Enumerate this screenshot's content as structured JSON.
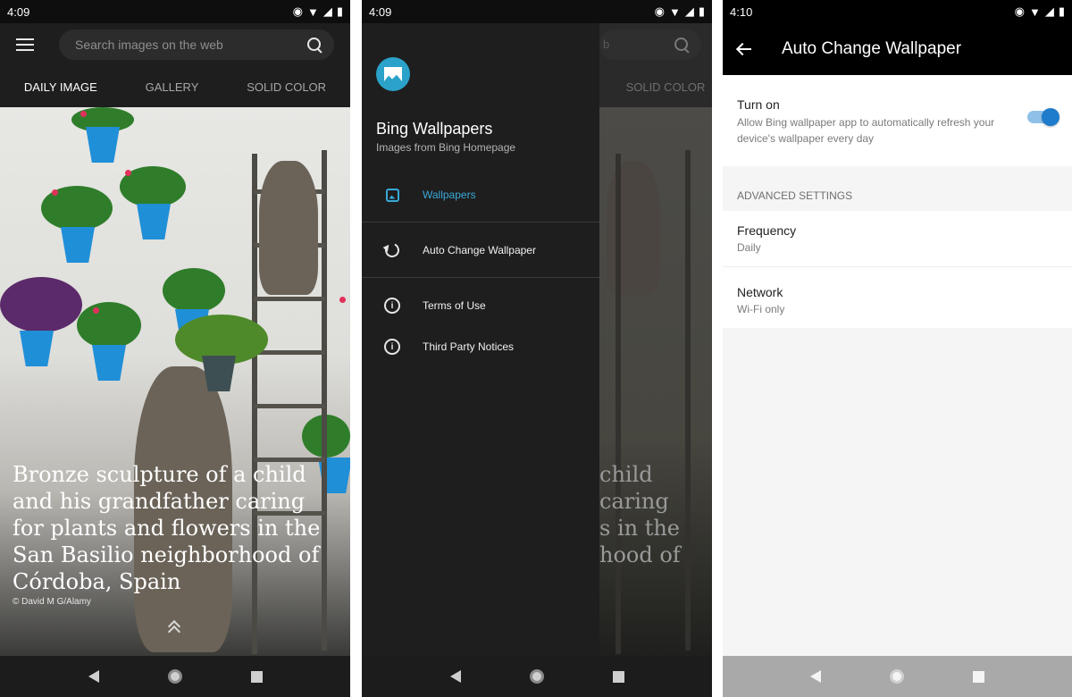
{
  "phone1": {
    "status": {
      "time": "4:09"
    },
    "search": {
      "placeholder": "Search images on the web"
    },
    "tabs": [
      {
        "label": "DAILY IMAGE",
        "active": true
      },
      {
        "label": "GALLERY",
        "active": false
      },
      {
        "label": "SOLID COLOR",
        "active": false
      }
    ],
    "caption": "Bronze sculpture of a child and his grandfather caring for plants and flowers in the San Basilio neighborhood of Córdoba, Spain",
    "credit": "© David M G/Alamy"
  },
  "phone2": {
    "status": {
      "time": "4:09"
    },
    "drawer": {
      "app_name": "Bing Wallpapers",
      "subtitle": "Images from Bing Homepage",
      "items": [
        {
          "label": "Wallpapers",
          "icon": "image-icon",
          "active": true
        },
        {
          "label": "Auto Change Wallpaper",
          "icon": "refresh-icon",
          "active": false
        },
        {
          "label": "Terms of Use",
          "icon": "info-icon",
          "active": false
        },
        {
          "label": "Third Party Notices",
          "icon": "info-icon",
          "active": false
        }
      ]
    },
    "behind": {
      "tab": "SOLID COLOR",
      "search_tail": "b",
      "caption_lines": [
        "child",
        "caring",
        "s in the",
        "hood of"
      ]
    }
  },
  "phone3": {
    "status": {
      "time": "4:10"
    },
    "title": "Auto Change Wallpaper",
    "turn_on": {
      "title": "Turn on",
      "description": "Allow Bing wallpaper app to automatically refresh your device's wallpaper every day",
      "enabled": true
    },
    "advanced_header": "ADVANCED SETTINGS",
    "settings": [
      {
        "title": "Frequency",
        "value": "Daily"
      },
      {
        "title": "Network",
        "value": "Wi-Fi only"
      }
    ]
  },
  "colors": {
    "accent": "#39a9d9",
    "toggle": "#1f7ccc",
    "dark_bg": "#1e1e1e"
  }
}
